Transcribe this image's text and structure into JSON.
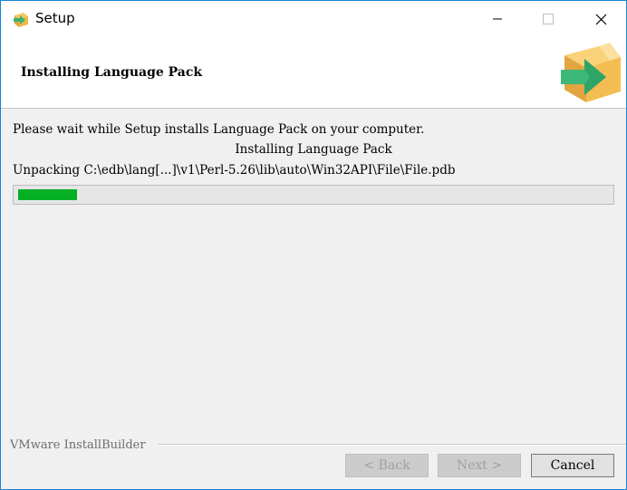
{
  "window": {
    "title": "Setup"
  },
  "header": {
    "title": "Installing Language Pack"
  },
  "content": {
    "message": "Please wait while Setup installs Language Pack on your computer.",
    "status": "Installing Language Pack",
    "current_file": "Unpacking C:\\edb\\lang[...]\\v1\\Perl-5.26\\lib\\auto\\Win32API\\File\\File.pdb",
    "progress_fraction": 0.1
  },
  "footer": {
    "brand": "VMware InstallBuilder",
    "back_label": "< Back",
    "next_label": "Next >",
    "cancel_label": "Cancel"
  },
  "icons": {
    "app": "installer-box-icon",
    "minimize": "minimize-icon",
    "maximize": "maximize-icon",
    "close": "close-icon",
    "header_logo": "installer-box-arrow-icon"
  },
  "colors": {
    "progress": "#06b025",
    "window_border": "#1883d7"
  }
}
